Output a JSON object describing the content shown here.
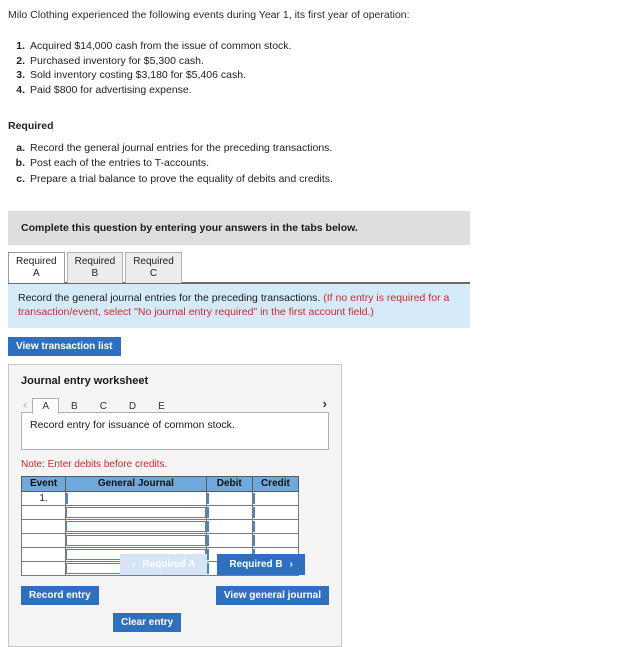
{
  "intro": "Milo Clothing experienced the following events during Year 1, its first year of operation:",
  "events": [
    {
      "num": "1.",
      "text": "Acquired $14,000 cash from the issue of common stock."
    },
    {
      "num": "2.",
      "text": "Purchased inventory for $5,300 cash."
    },
    {
      "num": "3.",
      "text": "Sold inventory costing $3,180 for $5,406 cash."
    },
    {
      "num": "4.",
      "text": "Paid $800 for advertising expense."
    }
  ],
  "required": {
    "heading": "Required",
    "items": [
      {
        "letter": "a.",
        "text": "Record the general journal entries for the preceding transactions."
      },
      {
        "letter": "b.",
        "text": "Post each of the entries to T-accounts."
      },
      {
        "letter": "c.",
        "text": "Prepare a trial balance to prove the equality of debits and credits."
      }
    ]
  },
  "complete_banner": "Complete this question by entering your answers in the tabs below.",
  "tabs": [
    {
      "label": "Required\nA",
      "active": true
    },
    {
      "label": "Required\nB",
      "active": false
    },
    {
      "label": "Required\nC",
      "active": false
    }
  ],
  "instruction": {
    "main": "Record the general journal entries for the preceding transactions. ",
    "red": "(If no entry is required for a transaction/event, select \"No journal entry required\" in the first account field.)"
  },
  "view_transaction_list": "View transaction list",
  "worksheet": {
    "title": "Journal entry worksheet",
    "prev_chevron": "‹",
    "next_chevron": "›",
    "letter_tabs": [
      {
        "label": "A",
        "active": true
      },
      {
        "label": "B",
        "active": false
      },
      {
        "label": "C",
        "active": false
      },
      {
        "label": "D",
        "active": false
      },
      {
        "label": "E",
        "active": false
      }
    ],
    "description": "Record entry for issuance of common stock.",
    "note": "Note: Enter debits before credits.",
    "columns": [
      "Event",
      "General Journal",
      "Debit",
      "Credit"
    ],
    "rows": [
      {
        "event": "1.",
        "general_journal": "",
        "debit": "",
        "credit": ""
      },
      {
        "event": "",
        "general_journal": "",
        "debit": "",
        "credit": ""
      },
      {
        "event": "",
        "general_journal": "",
        "debit": "",
        "credit": ""
      },
      {
        "event": "",
        "general_journal": "",
        "debit": "",
        "credit": ""
      },
      {
        "event": "",
        "general_journal": "",
        "debit": "",
        "credit": ""
      },
      {
        "event": "",
        "general_journal": "",
        "debit": "",
        "credit": ""
      }
    ],
    "record_entry": "Record entry",
    "clear_entry": "Clear entry",
    "view_general_journal": "View general journal"
  },
  "bottom_nav": {
    "prev_label": "Required A",
    "prev_chevron": "‹",
    "next_label": "Required B",
    "next_chevron": "›"
  },
  "colors": {
    "accent_blue": "#2f6fc0",
    "table_header_blue": "#6fa8dc",
    "instruction_banner": "#d4eaf8",
    "complete_banner": "#dedede",
    "red_text": "#cc2b2b",
    "disabled_nav": "#d6e4f7"
  }
}
